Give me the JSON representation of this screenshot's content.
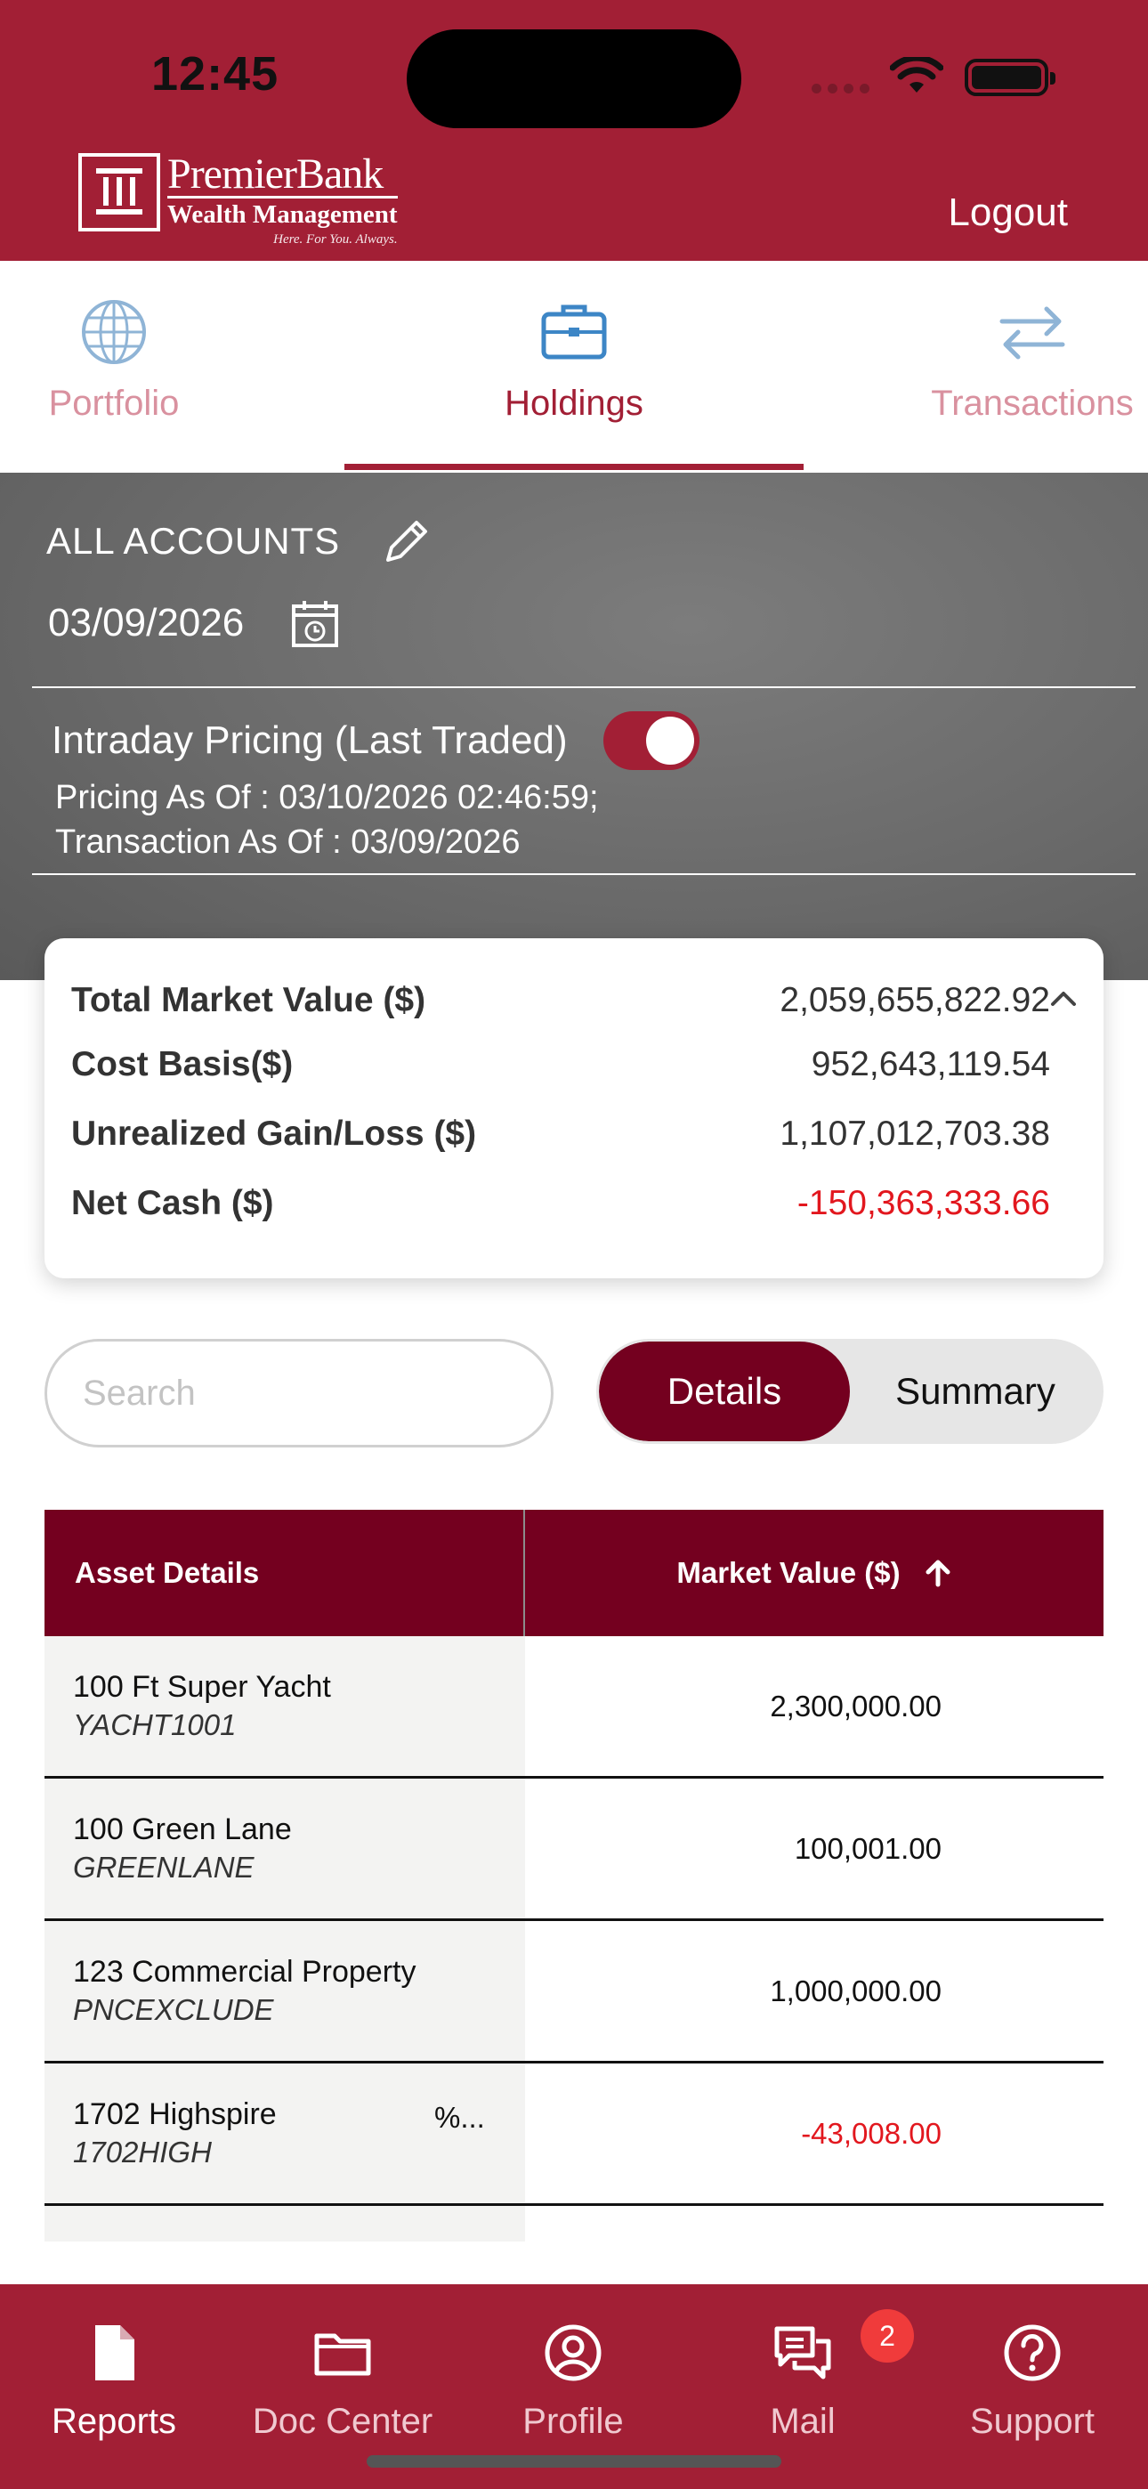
{
  "status_bar": {
    "time": "12:45"
  },
  "header": {
    "brand_name": "PremierBank",
    "brand_sub": "Wealth Management",
    "brand_tagline": "Here. For You. Always.",
    "logout_label": "Logout",
    "brand_color": "#A21F35"
  },
  "tabs": [
    {
      "label": "Portfolio",
      "icon": "globe-icon",
      "active": false
    },
    {
      "label": "Holdings",
      "icon": "briefcase-icon",
      "active": true
    },
    {
      "label": "Transactions",
      "icon": "transfer-arrows-icon",
      "active": false
    }
  ],
  "account": {
    "label": "ALL ACCOUNTS",
    "date": "03/09/2026",
    "intraday_label": "Intraday Pricing (Last Traded)",
    "intraday_on": true,
    "pricing_as_of": "Pricing As Of : 03/10/2026 02:46:59;",
    "transaction_as_of": "Transaction As Of : 03/09/2026"
  },
  "summary": {
    "metrics": [
      {
        "label": "Total Market Value ($)",
        "value": "2,059,655,822.92",
        "negative": false
      },
      {
        "label": "Cost Basis($)",
        "value": "952,643,119.54",
        "negative": false
      },
      {
        "label": "Unrealized Gain/Loss ($)",
        "value": "1,107,012,703.38",
        "negative": false
      },
      {
        "label": "Net Cash ($)",
        "value": "-150,363,333.66",
        "negative": true
      }
    ]
  },
  "controls": {
    "search_placeholder": "Search",
    "view_options": [
      "Details",
      "Summary"
    ],
    "selected_view": "Details"
  },
  "table": {
    "headers": {
      "asset": "Asset Details",
      "market_value": "Market Value ($)"
    },
    "sort": "ascending",
    "rows": [
      {
        "name": "100 Ft Super Yacht",
        "code": "YACHT1001",
        "pct": "",
        "value": "2,300,000.00",
        "negative": false
      },
      {
        "name": "100 Green Lane",
        "code": "GREENLANE",
        "pct": "",
        "value": "100,001.00",
        "negative": false
      },
      {
        "name": "123 Commercial Property",
        "code": "PNCEXCLUDE",
        "pct": "",
        "value": "1,000,000.00",
        "negative": false
      },
      {
        "name": "1702 Highspire",
        "code": "1702HIGH",
        "pct": "%...",
        "value": "-43,008.00",
        "negative": true
      }
    ]
  },
  "bottom_nav": {
    "items": [
      {
        "label": "Reports",
        "icon": "document-icon",
        "active": true
      },
      {
        "label": "Doc Center",
        "icon": "folder-icon",
        "active": false
      },
      {
        "label": "Profile",
        "icon": "user-circle-icon",
        "active": false
      },
      {
        "label": "Mail",
        "icon": "chat-bubbles-icon",
        "active": false
      },
      {
        "label": "Support",
        "icon": "help-circle-icon",
        "active": false
      }
    ],
    "mail_badge": "2"
  }
}
